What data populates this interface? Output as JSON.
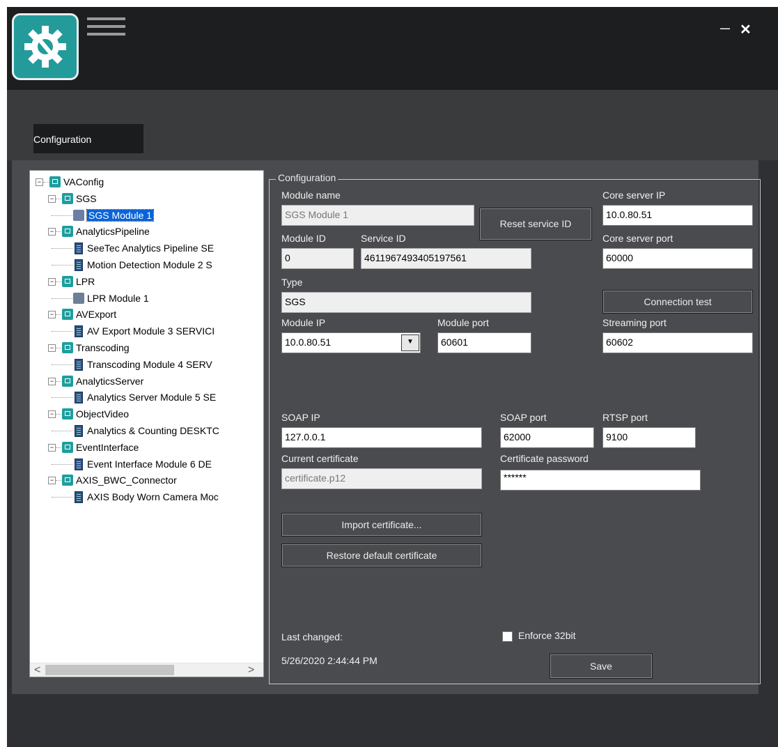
{
  "window": {
    "menu_icon": "hamburger-menu-icon",
    "minimize": "—",
    "close": "✕"
  },
  "tabs": {
    "configuration": "Configuration"
  },
  "tree": {
    "root": "VAConfig",
    "nodes": [
      {
        "label": "SGS",
        "icon": "monitor-icon",
        "children": [
          {
            "label": "SGS Module 1",
            "icon": "cameras-icon",
            "selected": true
          }
        ]
      },
      {
        "label": "AnalyticsPipeline",
        "icon": "runner-icon",
        "children": [
          {
            "label": "SeeTec Analytics Pipeline SE",
            "icon": "server-icon"
          },
          {
            "label": "Motion Detection Module 2 S",
            "icon": "server-icon"
          }
        ]
      },
      {
        "label": "LPR",
        "icon": "camera-icon",
        "children": [
          {
            "label": "LPR Module 1",
            "icon": "lpr-icon"
          }
        ]
      },
      {
        "label": "AVExport",
        "icon": "monitor-icon",
        "children": [
          {
            "label": "AV Export Module 3 SERVICI",
            "icon": "server-icon"
          }
        ]
      },
      {
        "label": "Transcoding",
        "icon": "gear-icon",
        "children": [
          {
            "label": "Transcoding Module 4 SERV",
            "icon": "server-icon"
          }
        ]
      },
      {
        "label": "AnalyticsServer",
        "icon": "monitor-icon",
        "children": [
          {
            "label": "Analytics Server Module 5 SE",
            "icon": "server-icon"
          }
        ]
      },
      {
        "label": "ObjectVideo",
        "icon": "monitor-icon",
        "children": [
          {
            "label": "Analytics & Counting DESKTC",
            "icon": "server-icon"
          }
        ]
      },
      {
        "label": "EventInterface",
        "icon": "monitor-icon",
        "children": [
          {
            "label": "Event Interface Module 6 DE",
            "icon": "server-icon"
          }
        ]
      },
      {
        "label": "AXIS_BWC_Connector",
        "icon": "monitor-icon",
        "children": [
          {
            "label": "AXIS Body Worn Camera Moc",
            "icon": "server-icon"
          }
        ]
      }
    ],
    "scroll_left": "<",
    "scroll_right": ">"
  },
  "config": {
    "group_title": "Configuration",
    "module_name_label": "Module name",
    "module_name": "SGS Module 1",
    "reset_button": "Reset service ID",
    "core_ip_label": "Core server IP",
    "core_ip": "10.0.80.51",
    "module_id_label": "Module ID",
    "module_id": "0",
    "service_id_label": "Service ID",
    "service_id": "4611967493405197561",
    "core_port_label": "Core server port",
    "core_port": "60000",
    "type_label": "Type",
    "type": "SGS",
    "connection_test": "Connection test",
    "module_ip_label": "Module IP",
    "module_ip": "10.0.80.51",
    "module_port_label": "Module port",
    "module_port": "60601",
    "streaming_port_label": "Streaming port",
    "streaming_port": "60602",
    "soap_ip_label": "SOAP IP",
    "soap_ip": "127.0.0.1",
    "soap_port_label": "SOAP port",
    "soap_port": "62000",
    "rtsp_port_label": "RTSP port",
    "rtsp_port": "9100",
    "cert_label": "Current certificate",
    "cert": "certificate.p12",
    "cert_pw_label": "Certificate password",
    "cert_pw": "******",
    "import_cert": "Import certificate...",
    "restore_cert": "Restore default certificate",
    "last_changed_label": "Last changed:",
    "last_changed": "5/26/2020 2:44:44 PM",
    "enforce_label": "Enforce 32bit",
    "enforce_checked": false,
    "save": "Save"
  }
}
